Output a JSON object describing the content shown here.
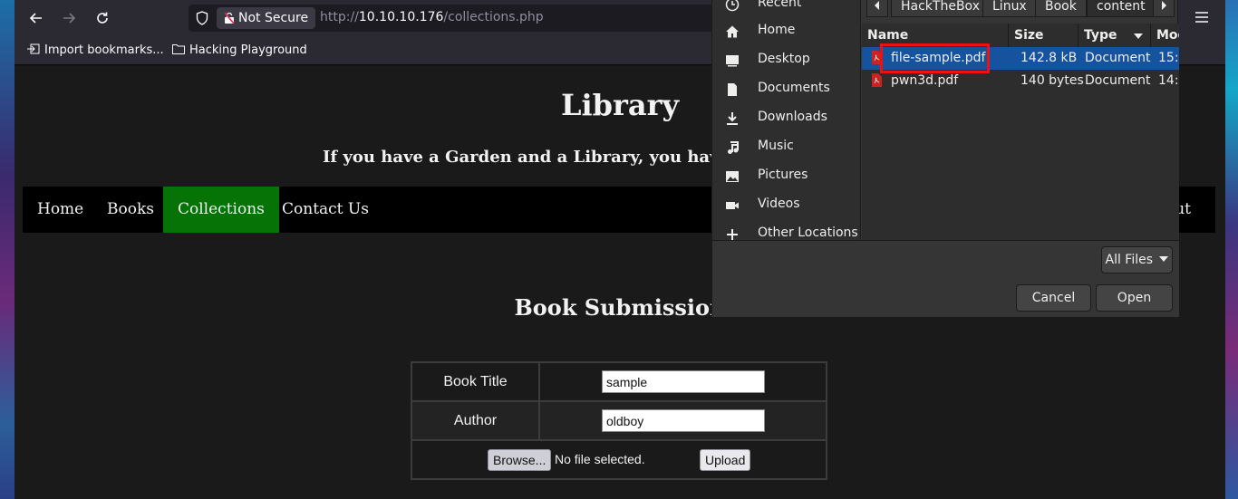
{
  "browser": {
    "back_icon": "arrow-left-icon",
    "forward_icon": "arrow-right-icon",
    "reload_icon": "reload-icon",
    "security_label": "Not Secure",
    "url_prefix": "http://",
    "url_host": "10.10.10.176",
    "url_path": "/collections.php",
    "bookmarks": [
      "Import bookmarks...",
      "Hacking Playground"
    ]
  },
  "page": {
    "site_title": "Library",
    "tagline": "If you have a Garden and a Library, you have",
    "nav": [
      "Home",
      "Books",
      "Collections",
      "Contact Us"
    ],
    "nav_partial_right": "out",
    "active_nav": "Collections",
    "accent_color": "#067306",
    "section_title": "Book Submission",
    "form": {
      "book_title_label": "Book Title",
      "book_title_value": "sample",
      "author_label": "Author",
      "author_value": "oldboy",
      "browse_label": "Browse...",
      "file_status": "No file selected.",
      "upload_label": "Upload"
    }
  },
  "dialog": {
    "places": [
      "Recent",
      "Home",
      "Desktop",
      "Documents",
      "Downloads",
      "Music",
      "Pictures",
      "Videos",
      "Other Locations"
    ],
    "breadcrumbs": [
      "HackTheBox",
      "Linux",
      "Book",
      "content"
    ],
    "columns": [
      "Name",
      "Size",
      "Type",
      "Mod"
    ],
    "files": [
      {
        "name": "file-sample.pdf",
        "size": "142.8 kB",
        "type": "Document",
        "modified": "15:",
        "selected": true
      },
      {
        "name": "pwn3d.pdf",
        "size": "140 bytes",
        "type": "Document",
        "modified": "14:",
        "selected": false
      }
    ],
    "filter_label": "All Files",
    "cancel_label": "Cancel",
    "open_label": "Open",
    "selection_color": "#15539e",
    "highlight_color": "#ee1111"
  }
}
